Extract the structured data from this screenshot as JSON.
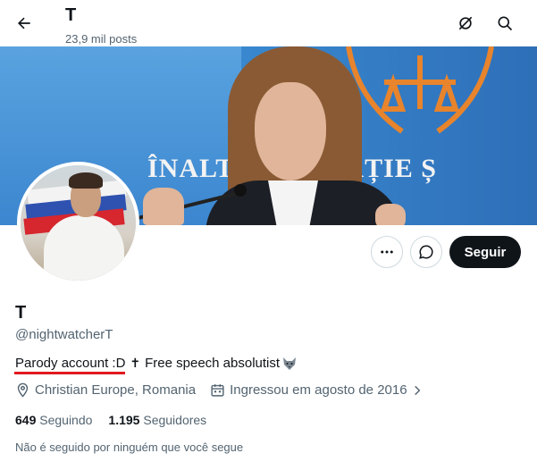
{
  "header": {
    "title": "T",
    "post_count": "23,9 mil posts",
    "icons": [
      "back-arrow-icon",
      "grok-icon",
      "search-icon"
    ]
  },
  "banner": {
    "inscription": "ÎNALT    DE CASAȚIE Ș"
  },
  "actions": {
    "more_icon": "ellipsis-icon",
    "message_icon": "message-icon",
    "follow_label": "Seguir"
  },
  "profile": {
    "name": "T",
    "handle": "@nightwatcherT",
    "bio": {
      "underlined_part": "Parody account :D",
      "cross": "✝",
      "rest": "Free speech absolutist"
    },
    "location": "Christian Europe, Romania",
    "joined": "Ingressou em agosto de 2016",
    "following_count": "649",
    "following_label": "Seguindo",
    "followers_count": "1.195",
    "followers_label": "Seguidores",
    "not_followed_note": "Não é seguido por ninguém que você segue"
  },
  "colors": {
    "text_primary": "#0f1419",
    "text_secondary": "#536471",
    "button_dark": "#0f1419",
    "annotation_underline": "#e0191f"
  }
}
